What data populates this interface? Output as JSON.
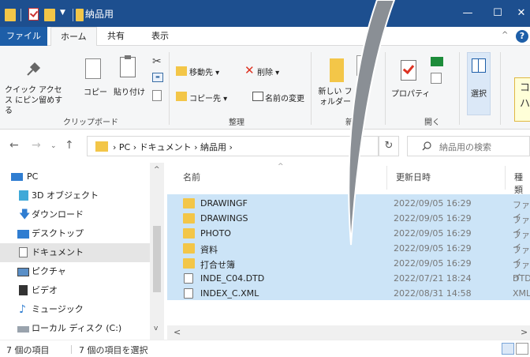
{
  "window": {
    "title": "納品用",
    "minimize_glyph": "—",
    "maximize_glyph": "☐",
    "close_glyph": "✕"
  },
  "ribbon_tabs": {
    "file": "ファイル",
    "home": "ホーム",
    "share": "共有",
    "view": "表示",
    "help": "?"
  },
  "ribbon": {
    "pin_label": "クイック アクセス にピン留めする",
    "copy_label": "コピー",
    "paste_label": "貼り付け",
    "clipboard_group": "クリップボード",
    "move_to": "移動先 ▾",
    "delete": "削除 ▾",
    "copy_to": "コピー先 ▾",
    "rename": "名前の変更",
    "organize_group": "整理",
    "new_folder": "新しい フォルダー",
    "new_group": "新規",
    "properties": "プロパティ",
    "open_group": "開く",
    "select": "選択"
  },
  "tooltip": {
    "line1": "コ",
    "line2": "ハ"
  },
  "address": {
    "path": "›  PC  ›  ドキュメント  ›  納品用  ›",
    "refresh_glyph": "↻",
    "search_placeholder": "納品用の検索"
  },
  "nav_pane": {
    "items": [
      {
        "label": "PC",
        "icon": "pc-icon"
      },
      {
        "label": "3D オブジェクト",
        "icon": "3d-objects-icon"
      },
      {
        "label": "ダウンロード",
        "icon": "download-icon"
      },
      {
        "label": "デスクトップ",
        "icon": "desktop-icon"
      },
      {
        "label": "ドキュメント",
        "icon": "documents-icon"
      },
      {
        "label": "ピクチャ",
        "icon": "pictures-icon"
      },
      {
        "label": "ビデオ",
        "icon": "video-icon"
      },
      {
        "label": "ミュージック",
        "icon": "music-icon"
      },
      {
        "label": "ローカル ディスク (C:)",
        "icon": "local-disk-icon"
      }
    ],
    "selected_index": 4
  },
  "file_list": {
    "columns": {
      "name": "名前",
      "date": "更新日時",
      "type": "種類"
    },
    "rows": [
      {
        "name": "DRAWINGF",
        "date": "2022/09/05 16:29",
        "type": "ファイ",
        "kind": "folder"
      },
      {
        "name": "DRAWINGS",
        "date": "2022/09/05 16:29",
        "type": "ファイ",
        "kind": "folder"
      },
      {
        "name": "PHOTO",
        "date": "2022/09/05 16:29",
        "type": "ファイ",
        "kind": "folder"
      },
      {
        "name": "資料",
        "date": "2022/09/05 16:29",
        "type": "ファイ",
        "kind": "folder"
      },
      {
        "name": "打合せ簿",
        "date": "2022/09/05 16:29",
        "type": "ファイ",
        "kind": "folder"
      },
      {
        "name": "INDE_C04.DTD",
        "date": "2022/07/21 18:24",
        "type": "DTD",
        "kind": "file"
      },
      {
        "name": "INDEX_C.XML",
        "date": "2022/08/31 14:58",
        "type": "XML",
        "kind": "file"
      }
    ]
  },
  "status": {
    "items_count": "7 個の項目",
    "selected_count": "7 個の項目を選択"
  },
  "colors": {
    "titlebar": "#1d4f8f",
    "selection": "#cce4f7",
    "folder": "#f3c648",
    "arrow": "#8a8f95"
  }
}
